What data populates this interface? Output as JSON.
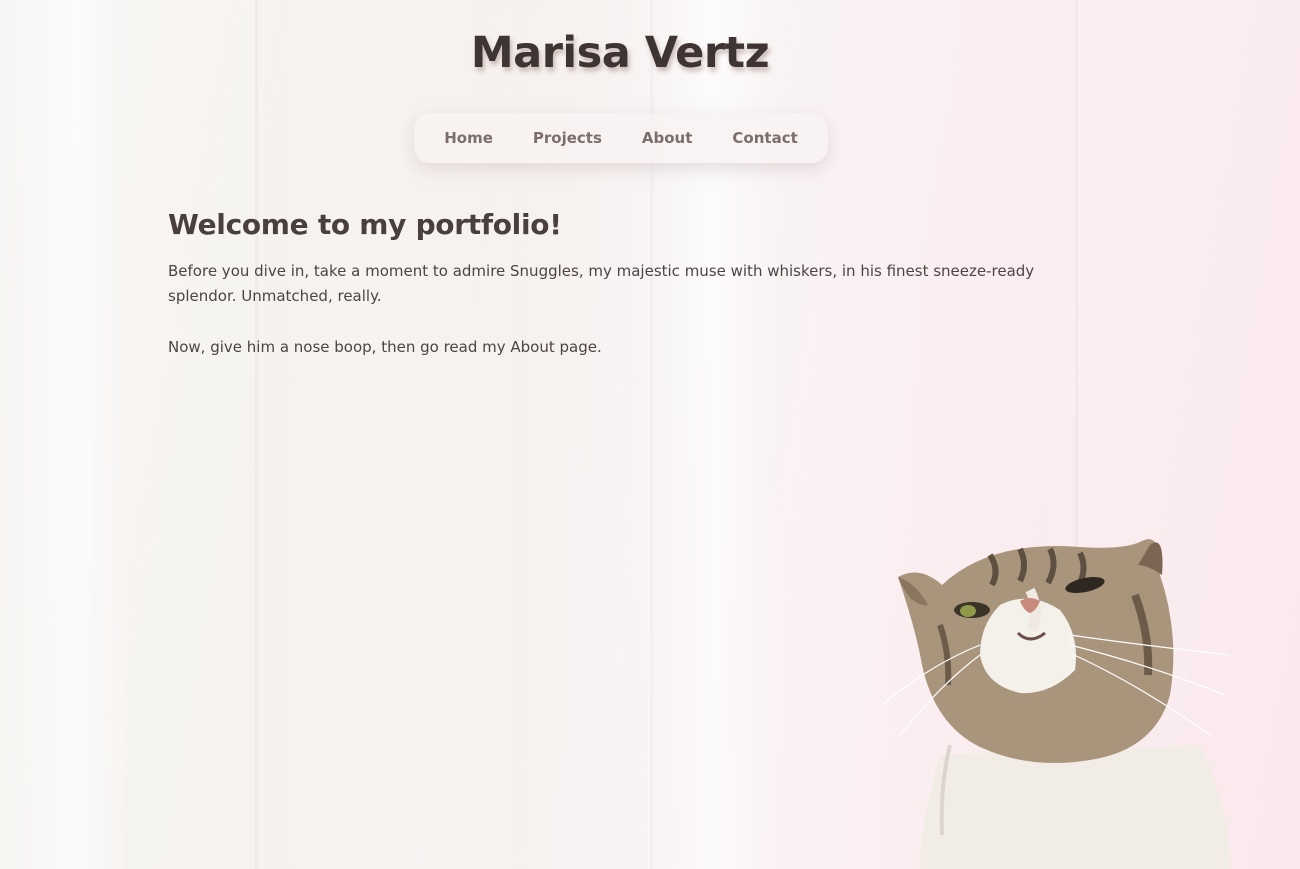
{
  "site": {
    "title": "Marisa Vertz"
  },
  "nav": {
    "items": [
      {
        "label": "Home"
      },
      {
        "label": "Projects"
      },
      {
        "label": "About"
      },
      {
        "label": "Contact"
      }
    ]
  },
  "main": {
    "heading": "Welcome to my portfolio!",
    "paragraph_1": "Before you dive in, take a moment to admire Snuggles, my majestic muse with whiskers, in his finest sneeze-ready splendor. Unmatched, really.",
    "paragraph_2": "Now, give him a nose boop, then go read my About page."
  },
  "colors": {
    "text": "#4a3f3f",
    "nav_text": "#7b6e6d",
    "background_start": "#f8f6f4",
    "background_end": "#fae8ec"
  }
}
